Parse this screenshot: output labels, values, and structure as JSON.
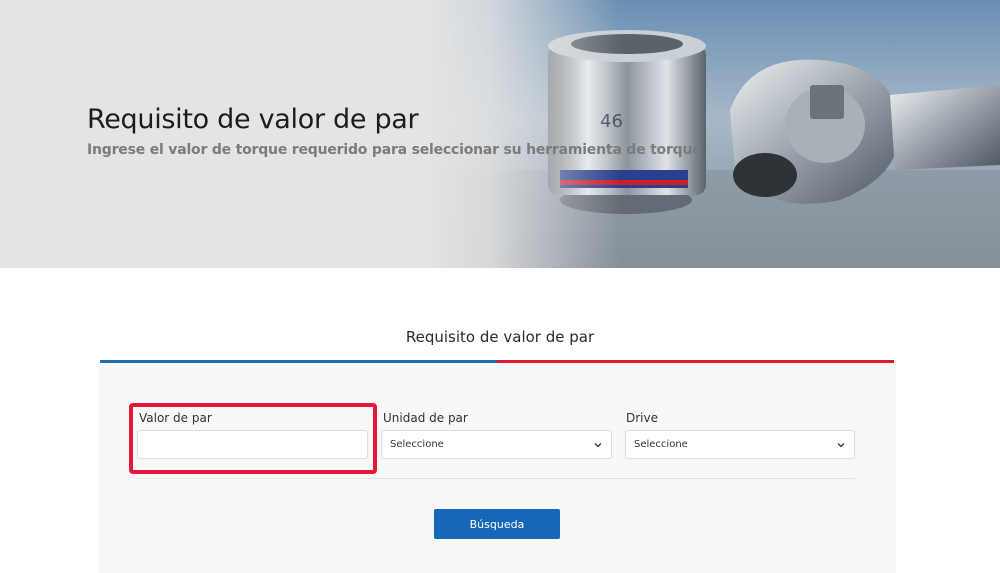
{
  "hero": {
    "title": "Requisito de valor de par",
    "subtitle": "Ingrese el valor de torque requerido para seleccionar su herramienta de torque"
  },
  "section": {
    "title": "Requisito de valor de par"
  },
  "form": {
    "torque_value": {
      "label": "Valor de par",
      "value": "",
      "placeholder": ""
    },
    "torque_unit": {
      "label": "Unidad de par",
      "selected": "Seleccione"
    },
    "drive": {
      "label": "Drive",
      "selected": "Seleccione"
    },
    "search_button": "Búsqueda"
  },
  "colors": {
    "accent_blue": "#1f6fb6",
    "accent_red": "#e2182c",
    "button_blue": "#1567b8",
    "highlight_red": "#e6173a"
  },
  "icons": {
    "select_chevron": "chevron-down-icon"
  }
}
